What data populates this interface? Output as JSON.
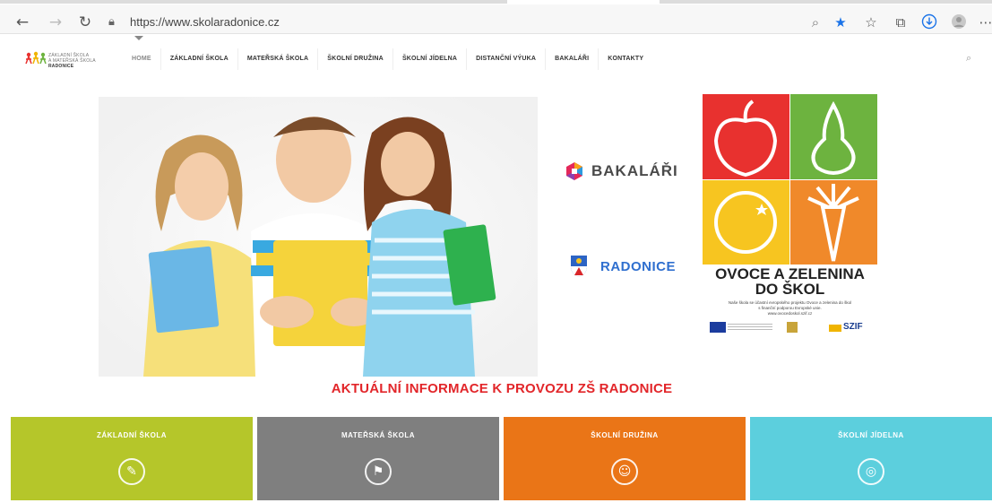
{
  "browser": {
    "url": "https://www.skolaradonice.cz",
    "icons": [
      "back-icon",
      "forward-icon",
      "reload-icon",
      "lock-icon",
      "zoom-icon",
      "favorite-star-icon",
      "favorites-icon",
      "collections-icon",
      "download-icon",
      "profile-icon",
      "more-icon"
    ]
  },
  "site": {
    "logo_line1": "ZÁKLADNÍ ŠKOLA",
    "logo_line2": "A MATEŘSKÁ ŠKOLA",
    "logo_bold": "RADONICE",
    "menu": [
      {
        "label": "HOME"
      },
      {
        "label": "ZÁKLADNÍ ŠKOLA"
      },
      {
        "label": "MATEŘSKÁ ŠKOLA"
      },
      {
        "label": "ŠKOLNÍ DRUŽINA"
      },
      {
        "label": "ŠKOLNÍ JÍDELNA"
      },
      {
        "label": "DISTANČNÍ VÝUKA"
      },
      {
        "label": "BAKALÁŘI"
      },
      {
        "label": "KONTAKTY"
      }
    ]
  },
  "hero": {
    "bakalari_label": "BAKALÁŘI",
    "radonice_label": "RADONICE"
  },
  "poster": {
    "title_line1": "OVOCE A ZELENINA",
    "title_line2": "DO ŠKOL",
    "sub_line1": "Naše škola se účastní evropského projektu Ovoce a zelenina do škol",
    "sub_line2": "s finanční podporou Evropské unie.",
    "sub_line3": "www.ovocedoskol.szif.cz",
    "szif": "SZIF",
    "colors": {
      "red": "#e8312f",
      "green": "#6db33f",
      "yellow": "#f7c520",
      "orange": "#f0892a"
    }
  },
  "announcement": "AKTUÁLNÍ INFORMACE K PROVOZU ZŠ RADONICE",
  "tiles": [
    {
      "label": "ZÁKLADNÍ ŠKOLA",
      "color": "#b5c62a",
      "icon": "school-icon"
    },
    {
      "label": "MATEŘSKÁ ŠKOLA",
      "color": "#7f7f7f",
      "icon": "kindergarten-icon"
    },
    {
      "label": "ŠKOLNÍ DRUŽINA",
      "color": "#ea7517",
      "icon": "children-icon"
    },
    {
      "label": "ŠKOLNÍ JÍDELNA",
      "color": "#5ccfdd",
      "icon": "plate-icon"
    }
  ]
}
